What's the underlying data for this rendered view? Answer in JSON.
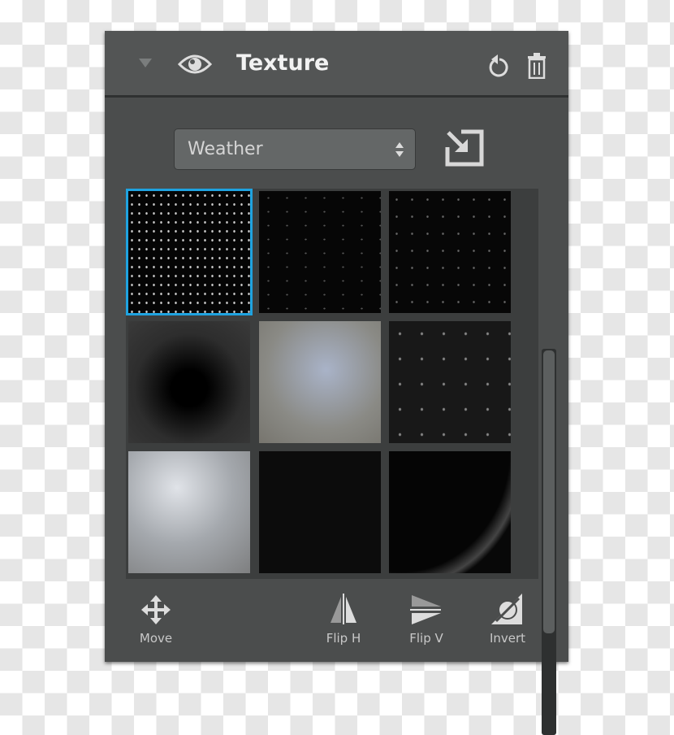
{
  "header": {
    "title": "Texture",
    "icons": [
      "collapse-triangle-icon",
      "eye-icon",
      "reset-icon",
      "trash-icon"
    ]
  },
  "category": {
    "selected": "Weather"
  },
  "import_icon": "import-icon",
  "textures": {
    "selected_index": 0,
    "count": 9
  },
  "toolbar": {
    "move": "Move",
    "flip_h": "Flip H",
    "flip_v": "Flip V",
    "invert": "Invert"
  },
  "colors": {
    "panel": "#4b4d4d",
    "header": "#535555",
    "accent": "#1fa3e0"
  }
}
